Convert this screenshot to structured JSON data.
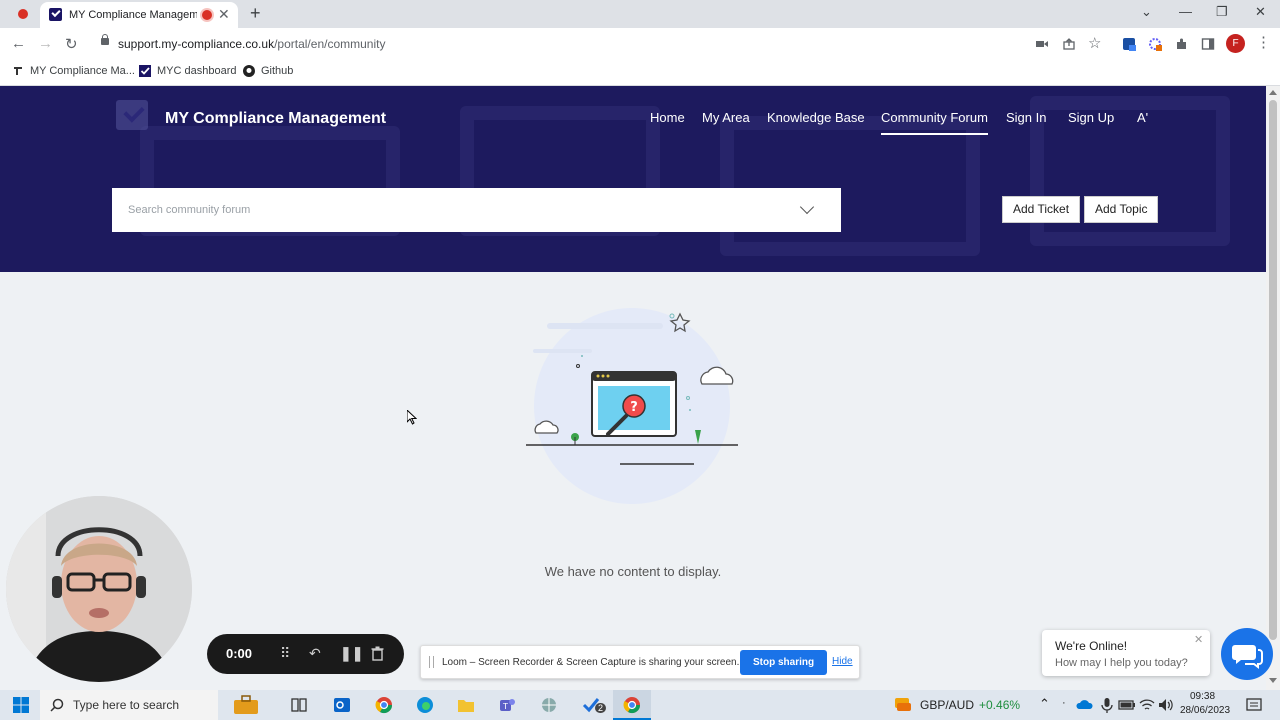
{
  "browser": {
    "tab_title": "MY Compliance Managem",
    "tab_close": "✕",
    "new_tab": "+",
    "url_host": "support.my-compliance.co.uk",
    "url_path": "/portal/en/community",
    "profile_initial": "F",
    "bookmarks": [
      "MY Compliance Ma...",
      "MYC dashboard",
      "Github"
    ]
  },
  "site": {
    "brand": "MY Compliance Management",
    "nav": [
      "Home",
      "My Area",
      "Knowledge Base",
      "Community Forum",
      "Sign In",
      "Sign Up",
      "A'"
    ],
    "active_nav": "Community Forum",
    "search_placeholder": "Search community forum",
    "add_ticket": "Add Ticket",
    "add_topic": "Add Topic",
    "empty_message": "We have no content to display."
  },
  "loom": {
    "timer": "0:00",
    "share_text": "Loom – Screen Recorder & Screen Capture is sharing your screen.",
    "stop_sharing": "Stop sharing",
    "hide": "Hide"
  },
  "chat": {
    "title": "We're Online!",
    "subtitle": "How may I help you today?"
  },
  "taskbar": {
    "search_placeholder": "Type here to search",
    "teams_badge": "2",
    "currency": "GBP/AUD",
    "currency_change": "+0.46%",
    "time": "09:38",
    "date": "28/06/2023"
  },
  "colors": {
    "hero_bg": "#1d1a5e",
    "accent": "#1a73e8",
    "currency_up": "#1e8e3e"
  }
}
